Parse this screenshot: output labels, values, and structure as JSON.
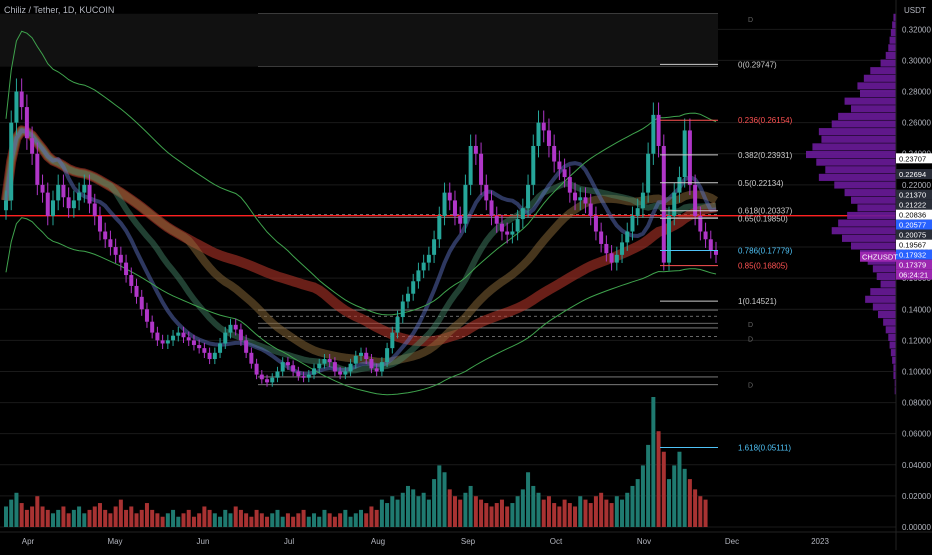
{
  "header": {
    "title": "Chiliz / Tether, 1D, KUCOIN",
    "currency": "USDT"
  },
  "colors": {
    "background": "#000000",
    "grid": "#1a1a1a",
    "up": "#26a69a",
    "down": "#ef5350",
    "magenta": "#b036c8",
    "red_line": "#ff2020",
    "fib_zero": "#cccccc",
    "fib_red": "#ff5252",
    "fib_blue": "#4fc3f7",
    "volume_profile": "#6a1b9a",
    "text": "#b2b5be"
  },
  "chart_data": {
    "type": "candlestick",
    "symbol": "CHZUSDT",
    "pair": "Chiliz / Tether",
    "exchange": "KUCOIN",
    "interval": "1D",
    "y_axis": {
      "ylim": [
        0,
        0.335
      ],
      "ticks": [
        "0.32000",
        "0.30000",
        "0.28000",
        "0.26000",
        "0.24000",
        "0.22000",
        "0.20000",
        "0.18000",
        "0.16000",
        "0.14000",
        "0.12000",
        "0.10000",
        "0.08000",
        "0.06000",
        "0.04000",
        "0.02000",
        "0.00000"
      ],
      "tick_values": [
        0.32,
        0.3,
        0.28,
        0.26,
        0.24,
        0.22,
        0.2,
        0.18,
        0.16,
        0.14,
        0.12,
        0.1,
        0.08,
        0.06,
        0.04,
        0.02,
        0.0
      ]
    },
    "x_axis": {
      "labels": [
        "Apr",
        "May",
        "Jun",
        "Jul",
        "Aug",
        "Sep",
        "Oct",
        "Nov",
        "Dec",
        "2023"
      ]
    },
    "price_labels": [
      {
        "value": 0.23707,
        "text": "0.23707",
        "style": "white"
      },
      {
        "value": 0.22694,
        "text": "0.22694",
        "style": "dark"
      },
      {
        "value": 0.2137,
        "text": "0.21370",
        "style": "dark"
      },
      {
        "value": 0.21222,
        "text": "0.21222",
        "style": "dark"
      },
      {
        "value": 0.20836,
        "text": "0.20836",
        "style": "white"
      },
      {
        "value": 0.20577,
        "text": "0.20577",
        "style": "blue"
      },
      {
        "value": 0.20075,
        "text": "0.20075",
        "style": "dark"
      },
      {
        "value": 0.19567,
        "text": "0.19567",
        "style": "white"
      },
      {
        "value": 0.17932,
        "text": "0.17932",
        "style": "blue"
      },
      {
        "value": 0.17379,
        "text": "0.17379",
        "style": "purple"
      },
      {
        "value": 0.16803,
        "text": "06:24:21",
        "style": "purple"
      }
    ],
    "symbol_tag": "CHZUSDT",
    "fib_levels": [
      {
        "ratio": "0",
        "price": 0.29747,
        "label": "0(0.29747)"
      },
      {
        "ratio": "0.236",
        "price": 0.26154,
        "label": "0.236(0.26154)"
      },
      {
        "ratio": "0.382",
        "price": 0.23931,
        "label": "0.382(0.23931)"
      },
      {
        "ratio": "0.5",
        "price": 0.22134,
        "label": "0.5(0.22134)"
      },
      {
        "ratio": "0.618",
        "price": 0.20337,
        "label": "0.618(0.20337)"
      },
      {
        "ratio": "0.65",
        "price": 0.1985,
        "label": "0.65(0.19850)"
      },
      {
        "ratio": "0.786",
        "price": 0.17779,
        "label": "0.786(0.17779)"
      },
      {
        "ratio": "0.85",
        "price": 0.16805,
        "label": "0.85(0.16805)"
      },
      {
        "ratio": "1",
        "price": 0.14521,
        "label": "1(0.14521)"
      },
      {
        "ratio": "1.618",
        "price": 0.05111,
        "label": "1.618(0.05111)"
      }
    ],
    "horizontal_levels": [
      0.33,
      0.3205,
      0.2975,
      0.296,
      0.201,
      0.199,
      0.1395,
      0.1355,
      0.131,
      0.128,
      0.1225,
      0.0965,
      0.0915
    ],
    "red_level": 0.2002,
    "d_markers": [
      0.3266,
      0.1305,
      0.1212,
      0.0915
    ],
    "close_series": [
      0.21,
      0.26,
      0.28,
      0.27,
      0.25,
      0.24,
      0.22,
      0.215,
      0.2,
      0.21,
      0.22,
      0.212,
      0.205,
      0.21,
      0.215,
      0.22,
      0.208,
      0.2,
      0.19,
      0.185,
      0.18,
      0.175,
      0.17,
      0.162,
      0.155,
      0.148,
      0.14,
      0.132,
      0.125,
      0.12,
      0.118,
      0.12,
      0.123,
      0.125,
      0.122,
      0.12,
      0.117,
      0.115,
      0.112,
      0.108,
      0.112,
      0.118,
      0.125,
      0.13,
      0.127,
      0.12,
      0.112,
      0.105,
      0.098,
      0.095,
      0.093,
      0.096,
      0.1,
      0.106,
      0.104,
      0.1,
      0.097,
      0.096,
      0.098,
      0.102,
      0.105,
      0.108,
      0.106,
      0.1,
      0.098,
      0.1,
      0.105,
      0.11,
      0.112,
      0.108,
      0.102,
      0.1,
      0.106,
      0.115,
      0.125,
      0.135,
      0.145,
      0.15,
      0.158,
      0.165,
      0.17,
      0.175,
      0.185,
      0.2,
      0.215,
      0.21,
      0.2,
      0.195,
      0.22,
      0.245,
      0.24,
      0.22,
      0.21,
      0.2,
      0.195,
      0.19,
      0.188,
      0.19,
      0.198,
      0.205,
      0.22,
      0.245,
      0.26,
      0.255,
      0.245,
      0.235,
      0.23,
      0.225,
      0.215,
      0.21,
      0.212,
      0.208,
      0.2,
      0.19,
      0.182,
      0.176,
      0.17,
      0.175,
      0.183,
      0.19,
      0.2,
      0.205,
      0.215,
      0.24,
      0.265,
      0.245,
      0.17,
      0.2,
      0.215,
      0.225,
      0.255,
      0.22,
      0.2,
      0.19,
      0.185,
      0.178,
      0.175
    ],
    "volume_series": [
      6,
      8,
      10,
      7,
      5,
      6,
      9,
      6,
      5,
      4,
      5,
      6,
      4,
      5,
      6,
      4,
      5,
      6,
      7,
      5,
      4,
      6,
      8,
      5,
      6,
      4,
      5,
      7,
      5,
      4,
      3,
      4,
      5,
      3,
      4,
      5,
      3,
      4,
      6,
      5,
      4,
      3,
      5,
      4,
      6,
      5,
      4,
      3,
      5,
      4,
      3,
      4,
      5,
      3,
      4,
      3,
      4,
      5,
      3,
      4,
      3,
      5,
      4,
      3,
      4,
      5,
      3,
      4,
      5,
      4,
      6,
      5,
      8,
      7,
      9,
      8,
      10,
      12,
      11,
      9,
      10,
      8,
      14,
      18,
      16,
      11,
      9,
      8,
      10,
      12,
      9,
      8,
      7,
      6,
      7,
      8,
      6,
      7,
      9,
      11,
      16,
      12,
      10,
      8,
      9,
      7,
      6,
      8,
      7,
      6,
      9,
      8,
      7,
      9,
      10,
      8,
      7,
      9,
      8,
      10,
      12,
      14,
      18,
      24,
      38,
      28,
      22,
      14,
      18,
      22,
      17,
      14,
      11,
      9,
      8
    ],
    "volume_profile": [
      2,
      3,
      4,
      5,
      6,
      8,
      12,
      20,
      25,
      30,
      28,
      40,
      35,
      45,
      50,
      60,
      58,
      65,
      70,
      62,
      55,
      60,
      48,
      40,
      35,
      30,
      38,
      45,
      50,
      42,
      35,
      28,
      22,
      18,
      15,
      12,
      20,
      24,
      18,
      14,
      10,
      8,
      6,
      5,
      4,
      3,
      2,
      2,
      1,
      1
    ]
  }
}
